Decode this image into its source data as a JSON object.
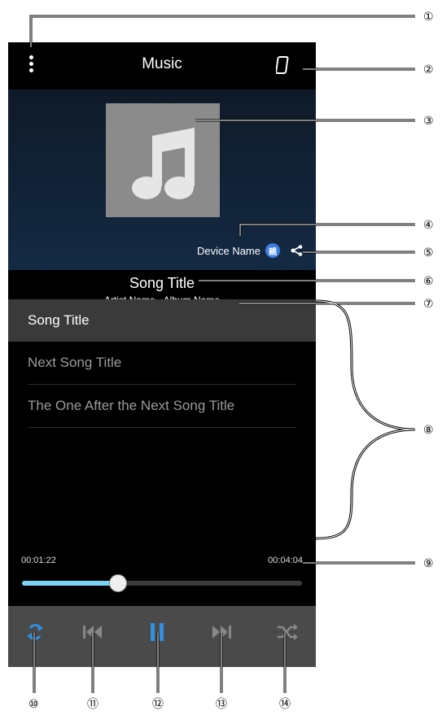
{
  "header": {
    "title": "Music"
  },
  "device": {
    "name": "Device Name",
    "badge": "親"
  },
  "now_playing": {
    "title": "Song Title",
    "subtitle": "Artist Name - Album Name"
  },
  "playlist": [
    {
      "label": "Song Title"
    },
    {
      "label": "Next Song Title"
    },
    {
      "label": "The One After the Next Song Title"
    }
  ],
  "progress": {
    "elapsed": "00:01:22",
    "total": "00:04:04",
    "fraction": 0.34
  },
  "colors": {
    "accent": "#2f8fe0",
    "progress": "#7ad3f5",
    "art": "#8b8b8b"
  },
  "icons": {
    "menu": "more-vert-icon",
    "device": "phone-icon",
    "share": "share-icon",
    "repeat": "repeat-icon",
    "prev": "skip-previous-icon",
    "pause": "pause-icon",
    "next": "skip-next-icon",
    "shuffle": "shuffle-icon"
  },
  "callouts": [
    "①",
    "②",
    "③",
    "④",
    "⑤",
    "⑥",
    "⑦",
    "⑧",
    "⑨",
    "⑩",
    "⑪",
    "⑫",
    "⑬",
    "⑭"
  ]
}
